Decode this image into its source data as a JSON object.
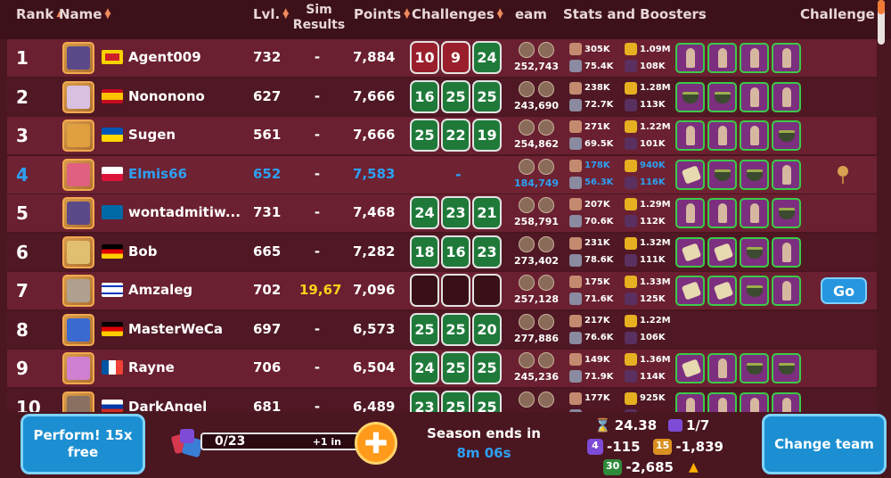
{
  "header": {
    "rank": "Rank",
    "name": "Name",
    "lvl": "Lvl.",
    "sim_results": [
      "Sim",
      "Results"
    ],
    "points": "Points",
    "challenges": "Challenges",
    "team": "eam",
    "stats_boosters": "Stats and Boosters",
    "challenge": "Challenge"
  },
  "rows": [
    {
      "rank": "1",
      "name": "Agent009",
      "lvl": "732",
      "sim": "-",
      "points": "7,884",
      "challenges": [
        "10",
        "9",
        "24"
      ],
      "chal_colors": [
        "r",
        "r",
        "g"
      ],
      "team_power": "252,743",
      "stats": [
        "305K",
        "1.09M",
        "75.4K",
        "108K"
      ]
    },
    {
      "rank": "2",
      "name": "Nononono",
      "lvl": "627",
      "sim": "-",
      "points": "7,666",
      "challenges": [
        "16",
        "25",
        "25"
      ],
      "chal_colors": [
        "g",
        "g",
        "g"
      ],
      "team_power": "243,690",
      "stats": [
        "238K",
        "1.28M",
        "72.7K",
        "113K"
      ]
    },
    {
      "rank": "3",
      "name": "Sugen",
      "lvl": "561",
      "sim": "-",
      "points": "7,666",
      "challenges": [
        "25",
        "22",
        "19"
      ],
      "chal_colors": [
        "g",
        "g",
        "g"
      ],
      "team_power": "254,862",
      "stats": [
        "271K",
        "1.22M",
        "69.5K",
        "101K"
      ]
    },
    {
      "rank": "4",
      "name": "Elmis66",
      "lvl": "652",
      "sim": "-",
      "points": "7,583",
      "challenges": [],
      "chal_dash": "-",
      "team_power": "184,749",
      "stats": [
        "178K",
        "940K",
        "56.3K",
        "116K"
      ]
    },
    {
      "rank": "5",
      "name": "wontadmitiw...",
      "lvl": "731",
      "sim": "-",
      "points": "7,468",
      "challenges": [
        "24",
        "23",
        "21"
      ],
      "chal_colors": [
        "g",
        "g",
        "g"
      ],
      "team_power": "258,791",
      "stats": [
        "207K",
        "1.29M",
        "70.6K",
        "112K"
      ]
    },
    {
      "rank": "6",
      "name": "Bob",
      "lvl": "665",
      "sim": "-",
      "points": "7,282",
      "challenges": [
        "18",
        "16",
        "23"
      ],
      "chal_colors": [
        "g",
        "g",
        "g"
      ],
      "team_power": "273,402",
      "stats": [
        "231K",
        "1.32M",
        "78.6K",
        "111K"
      ]
    },
    {
      "rank": "7",
      "name": "Amzaleg",
      "lvl": "702",
      "sim": "19,67",
      "points": "7,096",
      "challenges": [
        "",
        "",
        ""
      ],
      "chal_colors": [
        "e",
        "e",
        "e"
      ],
      "team_power": "257,128",
      "stats": [
        "175K",
        "1.33M",
        "71.6K",
        "125K"
      ],
      "go": "Go"
    },
    {
      "rank": "8",
      "name": "MasterWeCa",
      "lvl": "697",
      "sim": "-",
      "points": "6,573",
      "challenges": [
        "25",
        "25",
        "20"
      ],
      "chal_colors": [
        "g",
        "g",
        "g"
      ],
      "team_power": "277,886",
      "stats": [
        "217K",
        "1.22M",
        "76.6K",
        "106K"
      ]
    },
    {
      "rank": "9",
      "name": "Rayne",
      "lvl": "706",
      "sim": "-",
      "points": "6,504",
      "challenges": [
        "24",
        "25",
        "25"
      ],
      "chal_colors": [
        "g",
        "g",
        "g"
      ],
      "team_power": "245,236",
      "stats": [
        "149K",
        "1.36M",
        "71.9K",
        "114K"
      ]
    },
    {
      "rank": "10",
      "name": "DarkAngel",
      "lvl": "681",
      "sim": "-",
      "points": "6,489",
      "challenges": [
        "23",
        "25",
        "25"
      ],
      "chal_colors": [
        "g",
        "g",
        "g"
      ],
      "team_power": "",
      "stats": [
        "177K",
        "925K",
        "",
        ""
      ]
    }
  ],
  "footer": {
    "perform_label": "Perform! 15x free",
    "progress_text": "0/23",
    "progress_fraction": 0,
    "progress_inc": "+1 in",
    "season_label": "Season ends in",
    "season_time": "8m 06s",
    "score": "24.38",
    "ratio": "1/7",
    "tag4": "4",
    "val4": "-115",
    "tag15": "15",
    "val15": "-1,839",
    "tag30": "30",
    "val30": "-2,685",
    "change_team_label": "Change team"
  },
  "colors": {
    "accent_blue": "#2ea0f2",
    "gold": "#ffd21a",
    "green_box": "#1f7a3a",
    "red_box": "#9a1f2c"
  }
}
